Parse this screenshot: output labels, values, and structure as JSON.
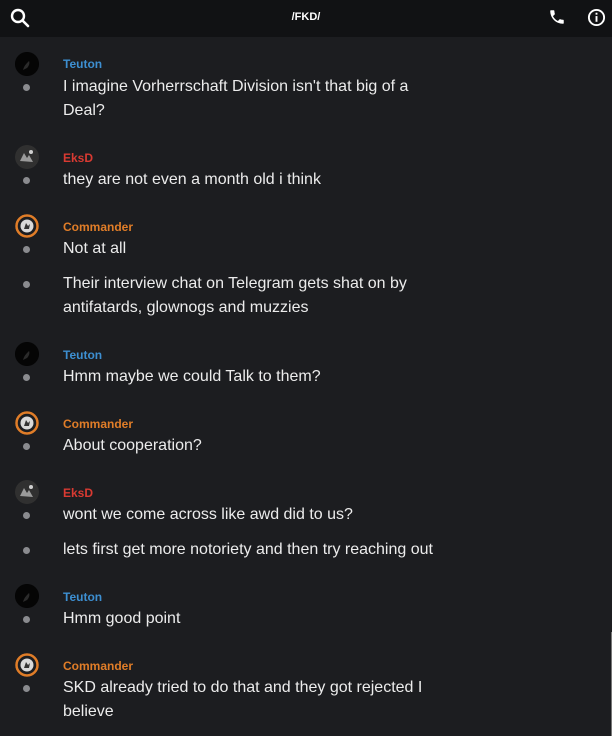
{
  "header": {
    "title": "/FKD/",
    "search_icon": "search-icon",
    "phone_icon": "phone-icon",
    "info_icon": "info-icon"
  },
  "colors": {
    "background": "#1c1d20",
    "topbar": "#111214",
    "teuton": "#3d8fd1",
    "eksd": "#d93a32",
    "commander": "#e07d28",
    "dot": "#8a8b8f"
  },
  "groups": [
    {
      "user": "Teuton",
      "avatar": "teuton-avatar",
      "messages": [
        "I imagine Vorherrschaft Division isn't that big of a Deal?"
      ]
    },
    {
      "user": "EksD",
      "avatar": "eksd-avatar",
      "messages": [
        "they are not even a month old i think"
      ]
    },
    {
      "user": "Commander",
      "avatar": "commander-avatar",
      "messages": [
        "Not at all",
        "Their interview chat on Telegram gets shat on by antifatards, glownogs and muzzies"
      ]
    },
    {
      "user": "Teuton",
      "avatar": "teuton-avatar",
      "messages": [
        "Hmm maybe we could Talk to them?"
      ]
    },
    {
      "user": "Commander",
      "avatar": "commander-avatar",
      "messages": [
        "About cooperation?"
      ]
    },
    {
      "user": "EksD",
      "avatar": "eksd-avatar",
      "messages": [
        "wont we come across like awd did to us?",
        "lets first get more notoriety and then try reaching out"
      ]
    },
    {
      "user": "Teuton",
      "avatar": "teuton-avatar",
      "messages": [
        "Hmm good point"
      ]
    },
    {
      "user": "Commander",
      "avatar": "commander-avatar",
      "messages": [
        "SKD already tried to do that and they got rejected I believe"
      ]
    }
  ]
}
